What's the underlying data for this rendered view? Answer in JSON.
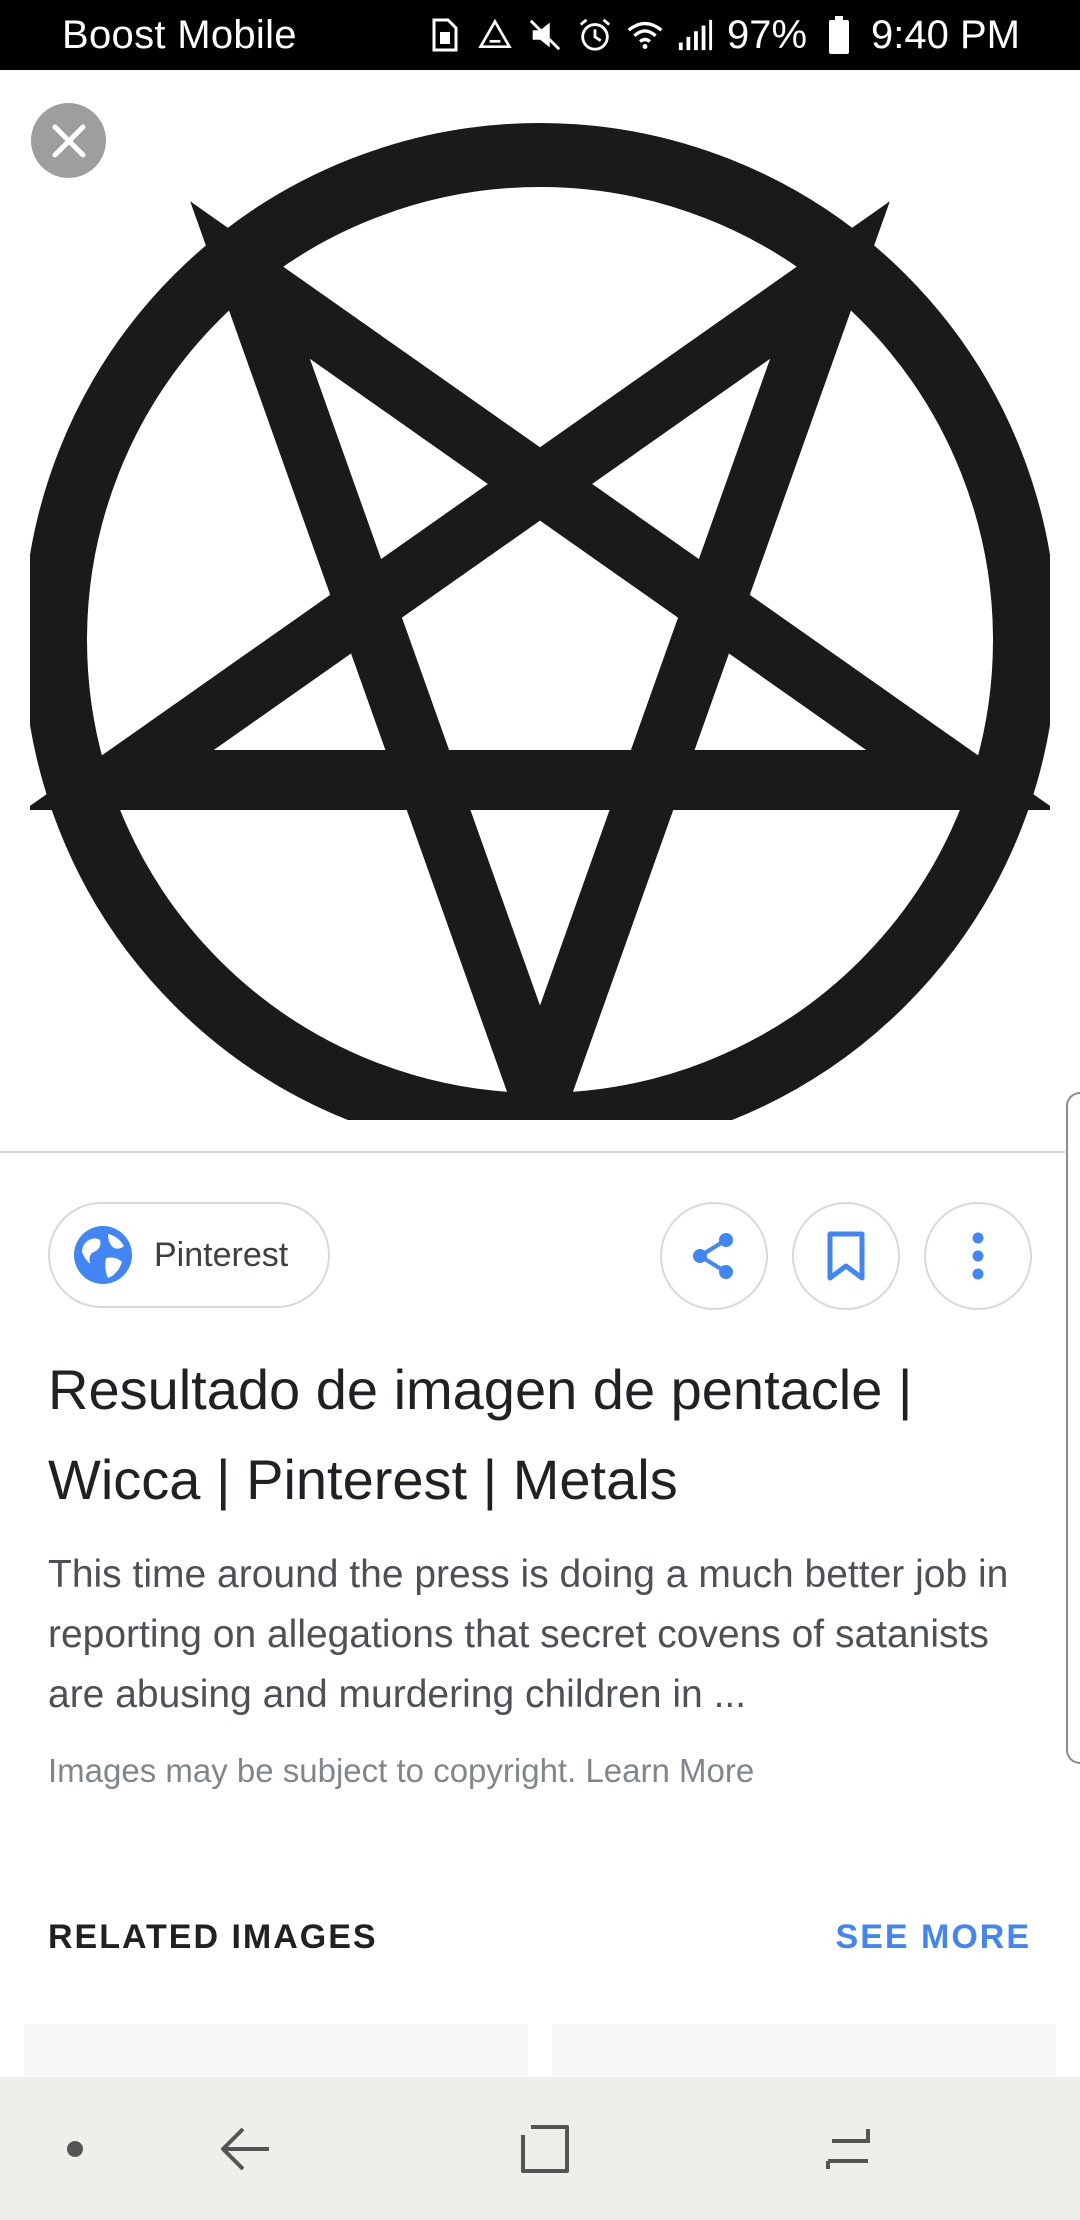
{
  "status_bar": {
    "carrier": "Boost Mobile",
    "battery_percent": "97%",
    "time": "9:40 PM",
    "icons": [
      "sim-icon",
      "recycle-icon",
      "mute-icon",
      "alarm-icon",
      "wifi-icon",
      "signal-icon",
      "battery-icon"
    ]
  },
  "image_viewer": {
    "close_icon": "close-icon",
    "image_subject": "pentacle"
  },
  "source": {
    "name": "Pinterest",
    "icon": "globe-icon"
  },
  "actions": {
    "share_icon": "share-icon",
    "bookmark_icon": "bookmark-icon",
    "more_icon": "more-vert-icon"
  },
  "result": {
    "title": "Resultado de imagen de pentacle | Wicca | Pinterest | Metals",
    "description": "This time around the press is doing a much better job in reporting on allegations that secret covens of satanists are abusing and murdering children in ...",
    "copyright_text": "Images may be subject to copyright.",
    "learn_more": "Learn More"
  },
  "related": {
    "heading": "RELATED IMAGES",
    "see_more": "SEE MORE"
  },
  "nav_bar": {
    "items": [
      "dot-icon",
      "back-icon",
      "home-icon",
      "recents-icon"
    ]
  },
  "colors": {
    "accent": "#4285f4",
    "status_bar_bg": "#000000",
    "nav_bar_bg": "#efeee8"
  }
}
